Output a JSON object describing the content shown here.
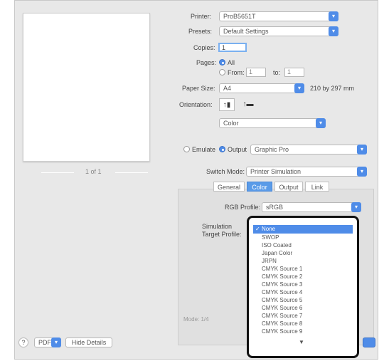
{
  "labels": {
    "printer": "Printer:",
    "presets": "Presets:",
    "copies": "Copies:",
    "pages": "Pages:",
    "paper_size": "Paper Size:",
    "orientation": "Orientation:",
    "rgb_profile": "RGB Profile:",
    "simulation_target": "Simulation Target Profile:",
    "edit_mode": "Switch Mode:"
  },
  "values": {
    "printer": "ProB5651T",
    "presets": "Default Settings",
    "copies": "1",
    "pages_all": "All",
    "pages_from": "From:",
    "pages_from_value": "1",
    "pages_to": "to:",
    "pages_to_value": "1",
    "paper_size": "A4",
    "paper_dims": "210 by 297 mm",
    "section": "Color",
    "source": "Emulate",
    "output_radio": "Output",
    "output_device": "Graphic Pro",
    "edit_mode": "Printer Simulation",
    "rgb_profile": "sRGB",
    "page_count": "1 of 1",
    "footer_note": "Mode: 1/4",
    "portrait": "↑▮",
    "landscape": "↑▬"
  },
  "tabs": [
    "General",
    "Color",
    "Output",
    "Link"
  ],
  "dropdown": [
    "None",
    "SWOP",
    "ISO Coated",
    "Japan Color",
    "JRPN",
    "CMYK Source 1",
    "CMYK Source 2",
    "CMYK Source 3",
    "CMYK Source 4",
    "CMYK Source 5",
    "CMYK Source 6",
    "CMYK Source 7",
    "CMYK Source 8",
    "CMYK Source 9"
  ],
  "dropdown_more": "▼",
  "footer": {
    "help": "?",
    "pdf": "PDF",
    "hide_details": "Hide Details"
  },
  "icons": {
    "checkmark": "checkmark-icon",
    "chevron": "chevron-down-icon"
  }
}
